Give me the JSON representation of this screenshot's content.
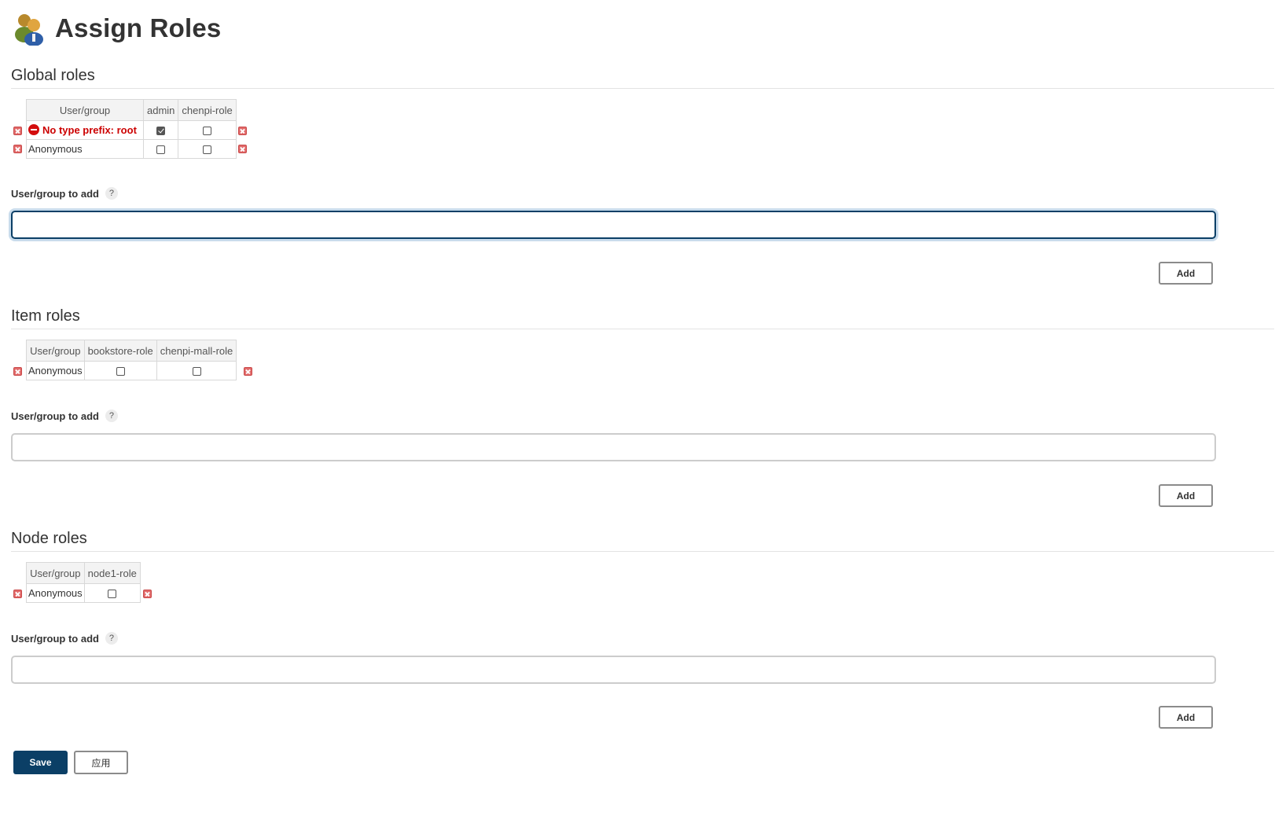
{
  "page": {
    "title": "Assign Roles",
    "icon": "users-icon"
  },
  "global_roles": {
    "title": "Global roles",
    "headers": [
      "User/group",
      "admin",
      "chenpi-role"
    ],
    "rows": [
      {
        "user": "No type prefix: root",
        "error": true,
        "checks": [
          true,
          false
        ]
      },
      {
        "user": "Anonymous",
        "error": false,
        "checks": [
          false,
          false
        ]
      }
    ],
    "add_label": "User/group to add",
    "help": "?",
    "input_value": "",
    "add_button": "Add"
  },
  "item_roles": {
    "title": "Item roles",
    "headers": [
      "User/group",
      "bookstore-role",
      "chenpi-mall-role"
    ],
    "rows": [
      {
        "user": "Anonymous",
        "error": false,
        "checks": [
          false,
          false
        ]
      }
    ],
    "add_label": "User/group to add",
    "help": "?",
    "input_value": "",
    "add_button": "Add"
  },
  "node_roles": {
    "title": "Node roles",
    "headers": [
      "User/group",
      "node1-role"
    ],
    "rows": [
      {
        "user": "Anonymous",
        "error": false,
        "checks": [
          false
        ]
      }
    ],
    "add_label": "User/group to add",
    "help": "?",
    "input_value": "",
    "add_button": "Add"
  },
  "footer": {
    "save_label": "Save",
    "apply_label": "应用"
  },
  "colors": {
    "primary": "#0b3f66",
    "error": "#cc0000",
    "delete": "#e26a6a"
  }
}
